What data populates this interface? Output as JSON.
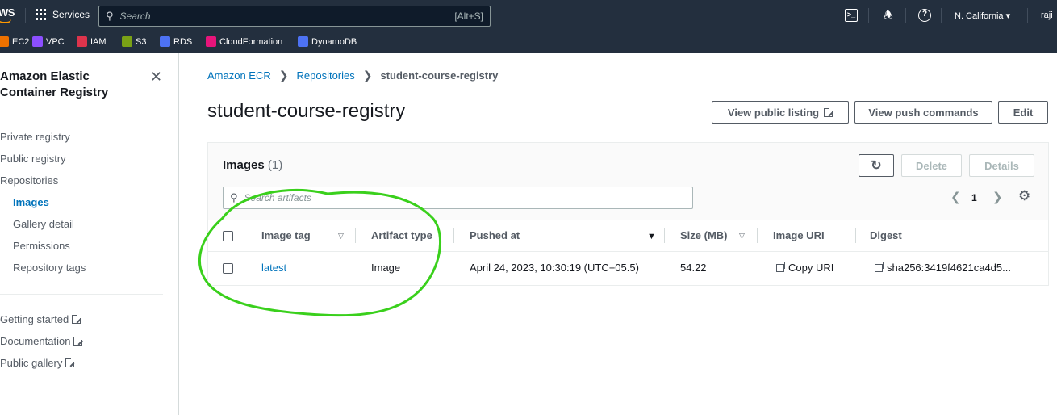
{
  "topbar": {
    "logo_text": "WS",
    "services_label": "Services",
    "search_placeholder": "Search",
    "search_shortcut": "[Alt+S]",
    "region": "N. California ▾",
    "user": "raji"
  },
  "favorites": [
    {
      "label": "EC2",
      "color": "#ed7100"
    },
    {
      "label": "VPC",
      "color": "#8c4fff"
    },
    {
      "label": "IAM",
      "color": "#dd344c"
    },
    {
      "label": "S3",
      "color": "#7aa116"
    },
    {
      "label": "RDS",
      "color": "#4d72f3"
    },
    {
      "label": "CloudFormation",
      "color": "#e7157b"
    },
    {
      "label": "DynamoDB",
      "color": "#4d72f3"
    }
  ],
  "sidebar": {
    "title": "Amazon Elastic Container Registry",
    "close_glyph": "✕",
    "items": [
      "Private registry",
      "Public registry",
      "Repositories",
      "Images",
      "Gallery detail",
      "Permissions",
      "Repository tags"
    ],
    "links": [
      "Getting started",
      "Documentation",
      "Public gallery"
    ]
  },
  "breadcrumb": {
    "items": [
      "Amazon ECR",
      "Repositories"
    ],
    "current": "student-course-registry",
    "sep": "❯"
  },
  "page": {
    "title": "student-course-registry",
    "buttons": {
      "view_public": "View public listing",
      "view_push": "View push commands",
      "edit": "Edit"
    }
  },
  "images_panel": {
    "title": "Images",
    "count": "(1)",
    "refresh_glyph": "↻",
    "delete_label": "Delete",
    "details_label": "Details",
    "filter_placeholder": "Search artifacts",
    "page": "1",
    "prev_glyph": "❮",
    "next_glyph": "❯",
    "settings_glyph": "⚙",
    "columns": [
      "Image tag",
      "Artifact type",
      "Pushed at",
      "Size (MB)",
      "Image URI",
      "Digest"
    ],
    "rows": [
      {
        "tag": "latest",
        "artifact_type": "Image",
        "pushed_at": "April 24, 2023, 10:30:19 (UTC+05.5)",
        "size": "54.22",
        "uri": "Copy URI",
        "digest": "sha256:3419f4621ca4d5..."
      }
    ]
  },
  "annotation_color": "#3ad01c"
}
